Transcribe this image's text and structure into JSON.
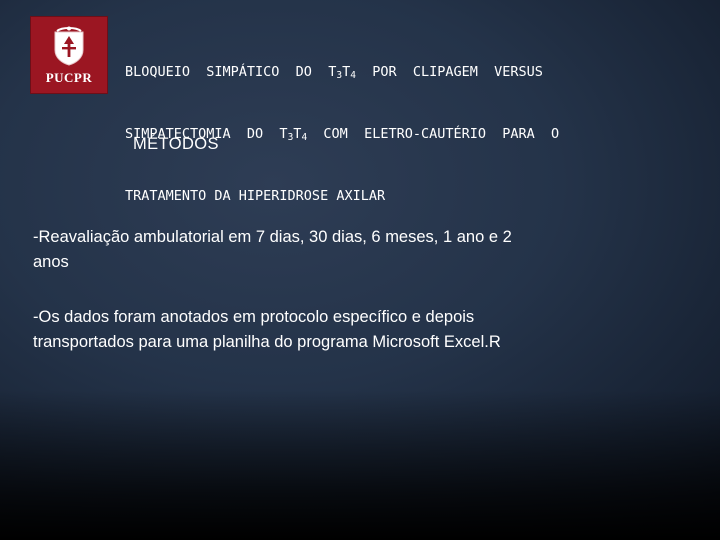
{
  "slide": {
    "logo": {
      "text": "PUCPR",
      "icon": "shield-crest-icon",
      "background_color": "#9b1622"
    },
    "title": {
      "line1": "BLOQUEIO  SIMPÁTICO  DO  T3T4  POR  CLIPAGEM  VERSUS",
      "line2": "SIMPATECTOMIA  DO  T3T4  COM  ELETRO-CAUTÉRIO  PARA  O",
      "line3": "TRATAMENTO DA HIPERIDROSE AXILAR",
      "segments": {
        "l1_a": "BLOQUEIO  SIMPÁTICO  DO  T",
        "l1_sub1": "3",
        "l1_b": "T",
        "l1_sub2": "4",
        "l1_c": "  POR  CLIPAGEM  VERSUS",
        "l2_a": "SIMPATECTOMIA  DO  T",
        "l2_sub1": "3",
        "l2_b": "T",
        "l2_sub2": "4",
        "l2_c": "  COM  ELETRO-CAUTÉRIO  PARA  O",
        "l3": "TRATAMENTO DA HIPERIDROSE AXILAR"
      }
    },
    "section_heading": "MÉTODOS",
    "bullets": {
      "bullet1": "-Reavaliação ambulatorial em 7 dias, 30 dias, 6 meses, 1 ano e 2 anos",
      "bullet1_head": "-Reavaliação ambulatorial em 7 dias, 30 dias, 6 meses, 1 ano e 2",
      "bullet1_tail": "anos",
      "bullet2": "-Os dados foram anotados em protocolo específico e depois transportados para uma planilha do programa Microsoft Excel.R",
      "bullet2_head": "-Os dados foram anotados em protocolo específico e depois",
      "bullet2_tail": "transportados para uma planilha do programa Microsoft Excel.R"
    },
    "colors": {
      "text": "#ffffff",
      "background_top": "#2e3d55",
      "background_bottom": "#000000",
      "logo_red": "#9b1622"
    }
  }
}
